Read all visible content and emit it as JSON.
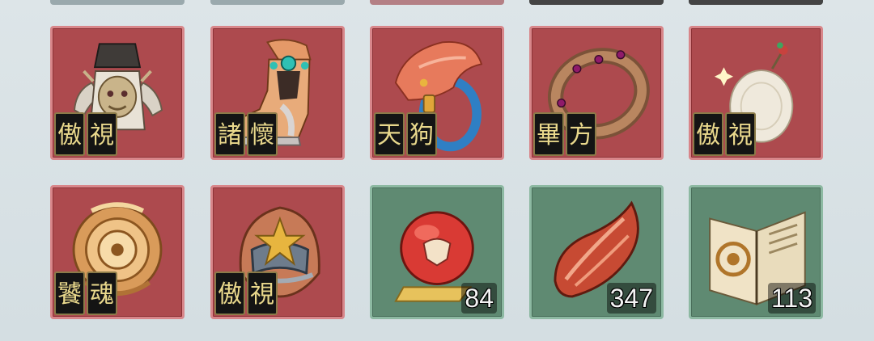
{
  "inventory": {
    "row1": [
      {
        "name": "armor",
        "seals": [
          "傲",
          "視"
        ]
      },
      {
        "name": "boots",
        "seals": [
          "諸",
          "懷"
        ]
      },
      {
        "name": "bracer",
        "seals": [
          "天",
          "狗"
        ]
      },
      {
        "name": "ring",
        "seals": [
          "畢",
          "方"
        ]
      },
      {
        "name": "jade-pendant",
        "seals": [
          "傲",
          "視"
        ]
      }
    ],
    "row2": [
      {
        "name": "medallion",
        "seals": [
          "饕",
          "魂"
        ]
      },
      {
        "name": "helmet",
        "seals": [
          "傲",
          "視"
        ]
      },
      {
        "name": "red-orb",
        "count": "84"
      },
      {
        "name": "flame-feather",
        "count": "347"
      },
      {
        "name": "bagua-book",
        "count": "113"
      }
    ]
  },
  "colors": {
    "equip_slot_bg": "#ad4a4e",
    "material_slot_bg": "#5f8a72",
    "seal_text": "#e9d88c"
  }
}
